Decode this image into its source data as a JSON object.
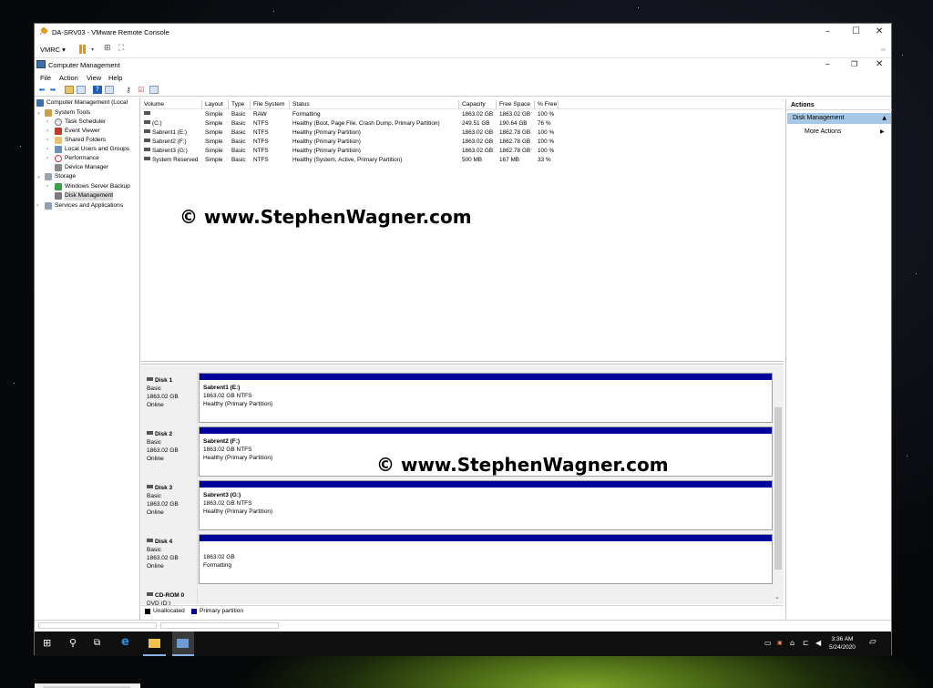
{
  "vm_window": {
    "title": "DA-SRV03 - VMware Remote Console",
    "menu": "VMRC ▾",
    "right_hint": "«c",
    "minimize": "–",
    "maximize": "☐",
    "close": "✕"
  },
  "app": {
    "title": "Computer Management",
    "minimize": "–",
    "restore": "❐",
    "close": "✕",
    "menu": [
      "File",
      "Action",
      "View",
      "Help"
    ]
  },
  "tree": {
    "root": "Computer Management (Local",
    "system_tools": "System Tools",
    "task_scheduler": "Task Scheduler",
    "event_viewer": "Event Viewer",
    "shared_folders": "Shared Folders",
    "local_users": "Local Users and Groups",
    "performance": "Performance",
    "device_manager": "Device Manager",
    "storage": "Storage",
    "wsb": "Windows Server Backup",
    "disk_management": "Disk Management",
    "services": "Services and Applications"
  },
  "volumes": {
    "columns": [
      "Volume",
      "Layout",
      "Type",
      "File System",
      "Status",
      "Capacity",
      "Free Space",
      "% Free"
    ],
    "rows": [
      [
        "",
        "Simple",
        "Basic",
        "RAW",
        "Formatting",
        "1863.02 GB",
        "1863.02 GB",
        "100 %"
      ],
      [
        "(C:)",
        "Simple",
        "Basic",
        "NTFS",
        "Healthy (Boot, Page File, Crash Dump, Primary Partition)",
        "249.51 GB",
        "190.64 GB",
        "76 %"
      ],
      [
        "Sabrent1 (E:)",
        "Simple",
        "Basic",
        "NTFS",
        "Healthy (Primary Partition)",
        "1863.02 GB",
        "1862.78 GB",
        "100 %"
      ],
      [
        "Sabrent2 (F:)",
        "Simple",
        "Basic",
        "NTFS",
        "Healthy (Primary Partition)",
        "1863.02 GB",
        "1862.78 GB",
        "100 %"
      ],
      [
        "Sabrent3 (G:)",
        "Simple",
        "Basic",
        "NTFS",
        "Healthy (Primary Partition)",
        "1863.02 GB",
        "1862.78 GB",
        "100 %"
      ],
      [
        "System Reserved",
        "Simple",
        "Basic",
        "NTFS",
        "Healthy (System, Active, Primary Partition)",
        "500 MB",
        "167 MB",
        "33 %"
      ]
    ]
  },
  "watermark": "© www.StephenWagner.com",
  "disks": [
    {
      "name": "Disk 1",
      "type": "Basic",
      "size": "1863.02 GB",
      "state": "Online",
      "part_name": "Sabrent1  (E:)",
      "part_size": "1863.02 GB NTFS",
      "part_status": "Healthy (Primary Partition)"
    },
    {
      "name": "Disk 2",
      "type": "Basic",
      "size": "1863.02 GB",
      "state": "Online",
      "part_name": "Sabrent2  (F:)",
      "part_size": "1863.02 GB NTFS",
      "part_status": "Healthy (Primary Partition)"
    },
    {
      "name": "Disk 3",
      "type": "Basic",
      "size": "1863.02 GB",
      "state": "Online",
      "part_name": "Sabrent3  (G:)",
      "part_size": "1863.02 GB NTFS",
      "part_status": "Healthy (Primary Partition)"
    },
    {
      "name": "Disk 4",
      "type": "Basic",
      "size": "1863.02 GB",
      "state": "Online",
      "part_name": "",
      "part_size": "1863.02 GB",
      "part_status": "Formatting"
    }
  ],
  "cdrom": {
    "name": "CD-ROM 0",
    "drive": "DVD (D:)"
  },
  "legend": {
    "unallocated": "Unallocated",
    "primary": "Primary partition",
    "unallocated_color": "#000000",
    "primary_color": "#00009a"
  },
  "actions": {
    "header": "Actions",
    "selected": "Disk Management",
    "more": "More Actions"
  },
  "taskbar": {
    "time": "3:36 AM",
    "date": "5/24/2020"
  }
}
